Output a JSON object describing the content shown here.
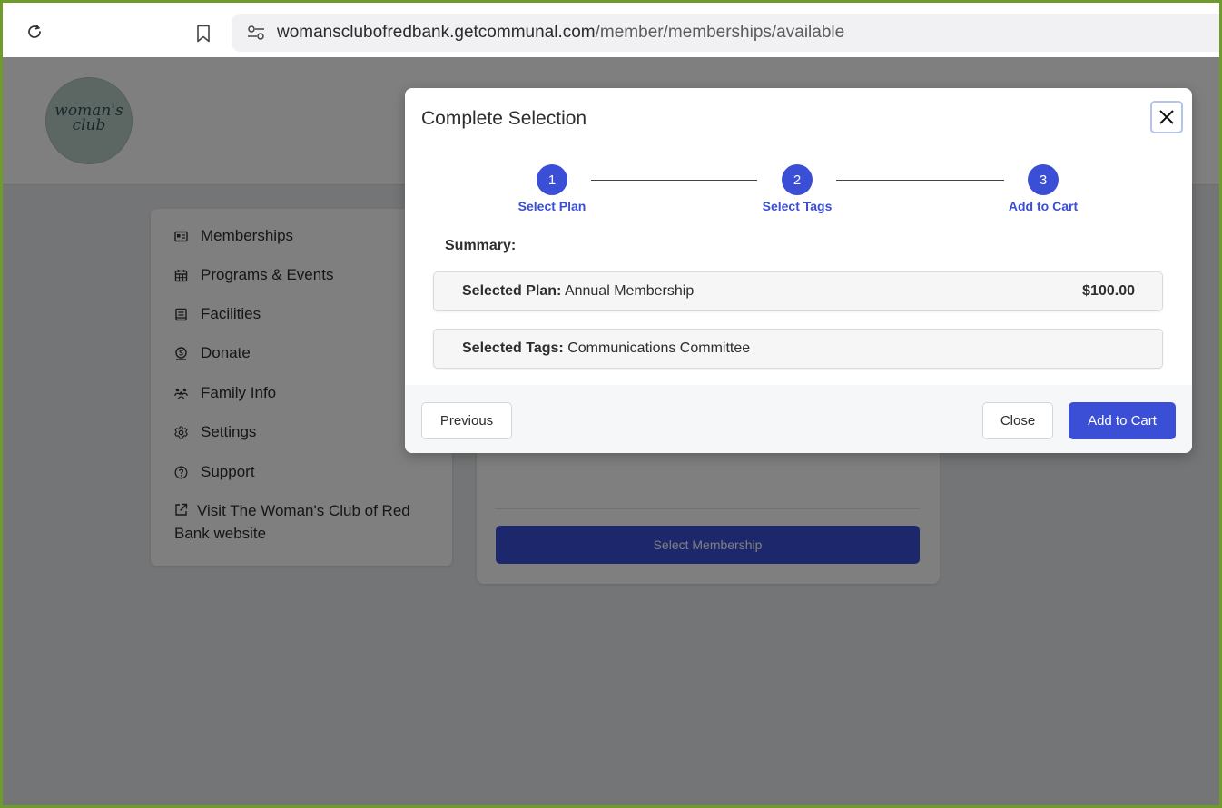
{
  "browser": {
    "url_domain": "womansclubofredbank.getcommunal.com",
    "url_path": "/member/memberships/available"
  },
  "site": {
    "logo_text_line1": "woman's",
    "logo_text_line2": "club"
  },
  "sidebar": {
    "items": [
      {
        "label": "Memberships",
        "icon": "membership-card-icon"
      },
      {
        "label": "Programs & Events",
        "icon": "calendar-icon"
      },
      {
        "label": "Facilities",
        "icon": "building-icon"
      },
      {
        "label": "Donate",
        "icon": "dollar-coin-icon"
      },
      {
        "label": "Family Info",
        "icon": "family-icon"
      },
      {
        "label": "Settings",
        "icon": "gear-icon"
      },
      {
        "label": "Support",
        "icon": "question-circle-icon"
      },
      {
        "label": "Visit The Woman's Club of Red Bank website",
        "icon": "external-link-icon"
      }
    ]
  },
  "card": {
    "button_label": "Select Membership"
  },
  "modal": {
    "title": "Complete Selection",
    "steps": [
      {
        "number": "1",
        "label": "Select Plan"
      },
      {
        "number": "2",
        "label": "Select Tags"
      },
      {
        "number": "3",
        "label": "Add to Cart"
      }
    ],
    "summary_label": "Summary:",
    "plan_label": "Selected Plan:",
    "plan_value": "Annual Membership",
    "plan_price": "$100.00",
    "tags_label": "Selected Tags:",
    "tags_value": "Communications Committee",
    "previous_label": "Previous",
    "close_label": "Close",
    "add_to_cart_label": "Add to Cart"
  },
  "colors": {
    "accent": "#3a4fd6",
    "frame_border": "#6f9a2c"
  }
}
